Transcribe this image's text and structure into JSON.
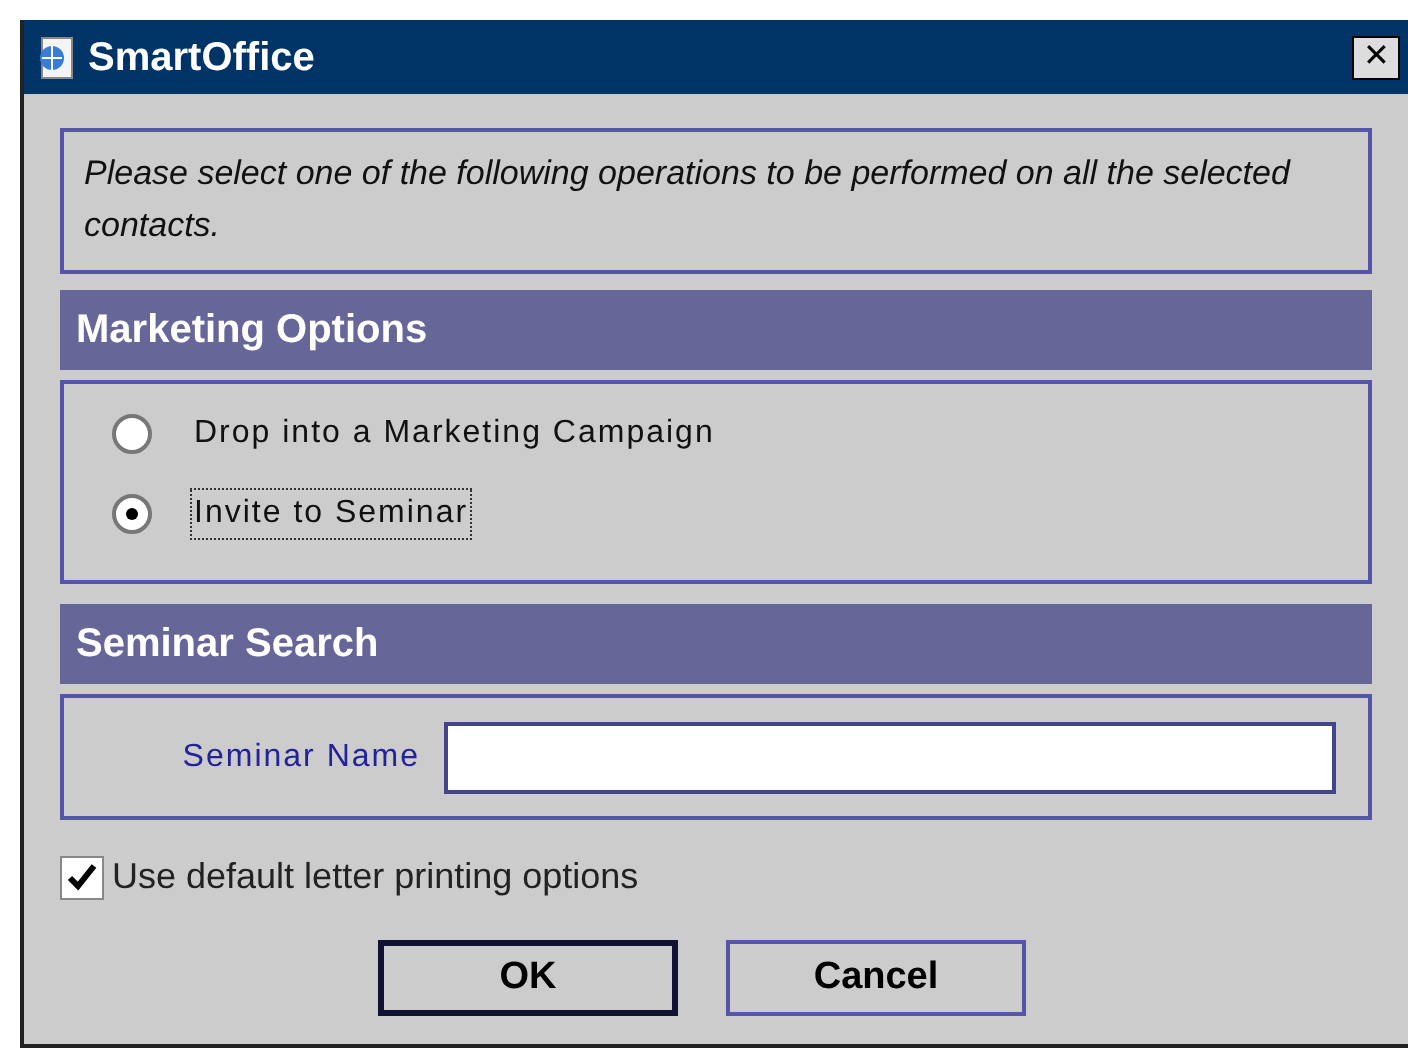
{
  "window": {
    "title": "SmartOffice",
    "close": "✕"
  },
  "instructions": "Please select one of the following operations to be performed on all the selected contacts.",
  "marketing_options": {
    "heading": "Marketing Options",
    "options": [
      {
        "label": "Drop into a Marketing Campaign",
        "selected": false,
        "focused": false
      },
      {
        "label": "Invite to Seminar",
        "selected": true,
        "focused": true
      }
    ]
  },
  "seminar_search": {
    "heading": "Seminar Search",
    "field_label": "Seminar Name"
  },
  "default_letter_options": {
    "label": "Use default letter printing options",
    "checked": true
  },
  "buttons": [
    {
      "label": "OK",
      "default": true
    },
    {
      "label": "Cancel",
      "default": false
    }
  ]
}
